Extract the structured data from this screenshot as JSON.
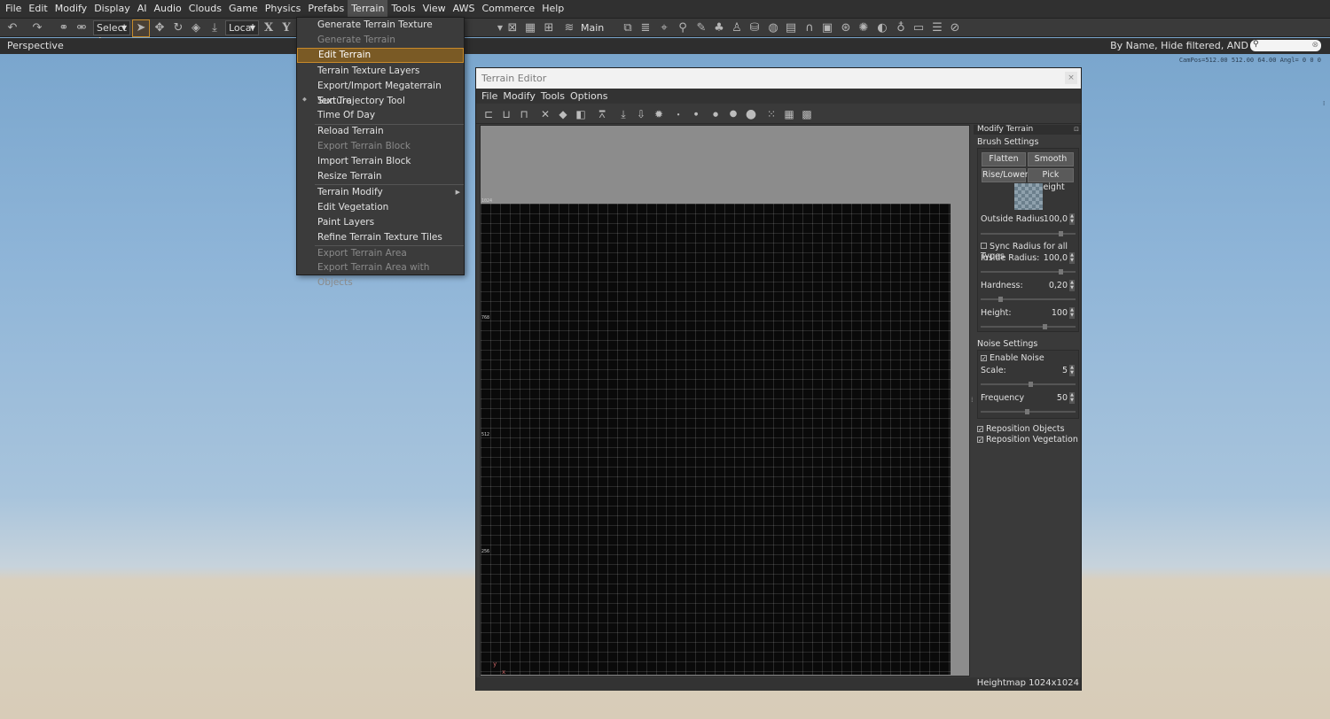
{
  "menubar": {
    "items": [
      "File",
      "Edit",
      "Modify",
      "Display",
      "AI",
      "Audio",
      "Clouds",
      "Game",
      "Physics",
      "Prefabs",
      "Terrain",
      "Tools",
      "View",
      "AWS",
      "Commerce",
      "Help"
    ],
    "active_index": 10
  },
  "toolbar": {
    "select_label": "Select A",
    "coord_label": "Local",
    "axis_x": "X",
    "axis_y": "Y",
    "layer_label": "Main"
  },
  "viewport": {
    "name": "Perspective",
    "filter_text": "By Name, Hide filtered, AND",
    "campos": "CamPos=512.00 512.00 64.00 Angl= 0 0 0"
  },
  "terrain_menu": {
    "items": [
      {
        "label": "Generate Terrain Texture",
        "disabled": false
      },
      {
        "label": "Generate Terrain",
        "disabled": true
      },
      {
        "label": "Edit Terrain",
        "disabled": false,
        "highlighted": true
      },
      {
        "label": "Terrain Texture Layers",
        "disabled": false
      },
      {
        "label": "Export/Import Megaterrain Texture",
        "disabled": false
      },
      {
        "label": "Sun Trajectory Tool",
        "disabled": false
      },
      {
        "label": "Time Of Day",
        "disabled": false
      },
      {
        "label": "Reload Terrain",
        "disabled": false
      },
      {
        "label": "Export Terrain Block",
        "disabled": true
      },
      {
        "label": "Import Terrain Block",
        "disabled": false
      },
      {
        "label": "Resize Terrain",
        "disabled": false
      },
      {
        "label": "Terrain Modify",
        "disabled": false,
        "submenu": true
      },
      {
        "label": "Edit Vegetation",
        "disabled": false
      },
      {
        "label": "Paint Layers",
        "disabled": false
      },
      {
        "label": "Refine Terrain Texture Tiles",
        "disabled": false
      },
      {
        "label": "Export Terrain Area",
        "disabled": true
      },
      {
        "label": "Export Terrain Area with Objects",
        "disabled": true
      }
    ]
  },
  "editor": {
    "title": "Terrain Editor",
    "close": "×",
    "menu": [
      "File",
      "Modify",
      "Tools",
      "Options"
    ],
    "status": "Heightmap 1024x1024",
    "axis_labels": [
      "1024",
      "768",
      "512",
      "256"
    ],
    "axis_x": "x",
    "axis_y": "y"
  },
  "panel": {
    "title": "Modify Terrain",
    "brush_settings": "Brush Settings",
    "buttons": {
      "flatten": "Flatten",
      "smooth": "Smooth",
      "rise_lower": "Rise/Lower",
      "pick_height": "Pick Height"
    },
    "outside_radius": {
      "label": "Outside Radius",
      "value": "100,0"
    },
    "sync_radius": {
      "label": "Sync Radius for all Types",
      "checked": false
    },
    "inside_radius": {
      "label": "Inside Radius:",
      "value": "100,0"
    },
    "hardness": {
      "label": "Hardness:",
      "value": "0,20"
    },
    "height": {
      "label": "Height:",
      "value": "100"
    },
    "noise_settings": "Noise Settings",
    "enable_noise": {
      "label": "Enable Noise",
      "checked": true
    },
    "scale": {
      "label": "Scale:",
      "value": "5"
    },
    "frequency": {
      "label": "Frequency",
      "value": "50"
    },
    "reposition_objects": {
      "label": "Reposition Objects",
      "checked": true
    },
    "reposition_vegetation": {
      "label": "Reposition Vegetation",
      "checked": true
    }
  },
  "colors": {
    "menu_bg": "#303030",
    "highlight": "#7a5a25",
    "highlight_border": "#c88a2a",
    "sky": "#8fb5d8",
    "ground": "#d8ccb8"
  }
}
